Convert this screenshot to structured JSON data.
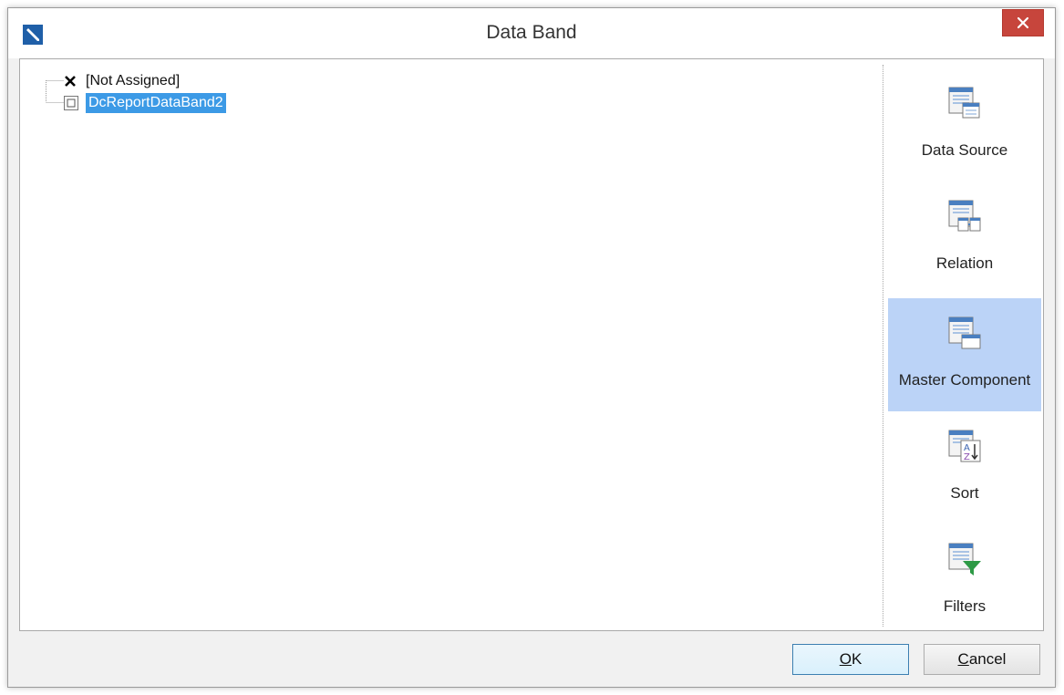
{
  "window": {
    "title": "Data Band"
  },
  "tree": {
    "items": [
      {
        "label": "[Not Assigned]",
        "icon": "x-icon",
        "selected": false
      },
      {
        "label": "DcReportDataBand2",
        "icon": "box-icon",
        "selected": true
      }
    ]
  },
  "sidebar": {
    "items": [
      {
        "label": "Data Source",
        "icon": "data-source-icon",
        "active": false
      },
      {
        "label": "Relation",
        "icon": "relation-icon",
        "active": false
      },
      {
        "label": "Master Component",
        "icon": "master-component-icon",
        "active": true
      },
      {
        "label": "Sort",
        "icon": "sort-icon",
        "active": false
      },
      {
        "label": "Filters",
        "icon": "filter-icon",
        "active": false
      }
    ]
  },
  "buttons": {
    "ok": {
      "mnemonic": "O",
      "rest": "K"
    },
    "cancel": {
      "mnemonic": "C",
      "rest": "ancel"
    }
  },
  "colors": {
    "selection": "#3c9ae6",
    "active_sidebar": "#bbd3f7",
    "close_button": "#c7453c"
  }
}
